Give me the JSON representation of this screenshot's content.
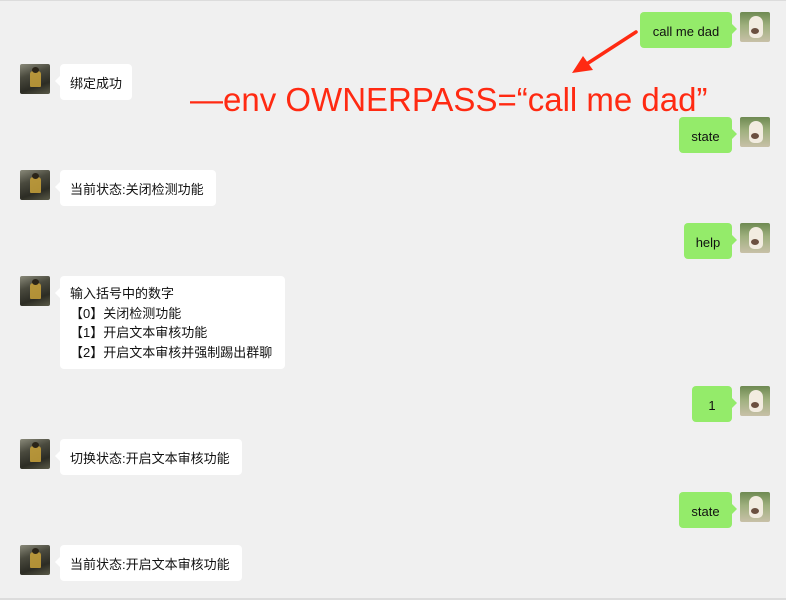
{
  "chat": {
    "messages": [
      {
        "sender": "user",
        "avatar_icon": "alpaca-avatar-icon",
        "text": "call me dad"
      },
      {
        "sender": "bot",
        "avatar_icon": "robot-avatar-icon",
        "text": "绑定成功"
      },
      {
        "sender": "user",
        "avatar_icon": "alpaca-avatar-icon",
        "text": "state"
      },
      {
        "sender": "bot",
        "avatar_icon": "robot-avatar-icon",
        "text": "当前状态:关闭检测功能"
      },
      {
        "sender": "user",
        "avatar_icon": "alpaca-avatar-icon",
        "text": "help"
      },
      {
        "sender": "bot",
        "avatar_icon": "robot-avatar-icon",
        "lines": [
          "输入括号中的数字",
          "【0】关闭检测功能",
          "【1】开启文本审核功能",
          "【2】开启文本审核并强制踢出群聊"
        ]
      },
      {
        "sender": "user",
        "avatar_icon": "alpaca-avatar-icon",
        "text": "1"
      },
      {
        "sender": "bot",
        "avatar_icon": "robot-avatar-icon",
        "text": "切换状态:开启文本审核功能"
      },
      {
        "sender": "user",
        "avatar_icon": "alpaca-avatar-icon",
        "text": "state"
      },
      {
        "sender": "bot",
        "avatar_icon": "robot-avatar-icon",
        "text": "当前状态:开启文本审核功能"
      }
    ]
  },
  "annotation": {
    "text": "—env OWNERPASS=“call me dad”",
    "color": "#ff2a12",
    "arrow_icon": "red-arrow-icon"
  },
  "colors": {
    "background": "#f0f0f0",
    "user_bubble": "#94eb6a",
    "bot_bubble": "#ffffff"
  }
}
